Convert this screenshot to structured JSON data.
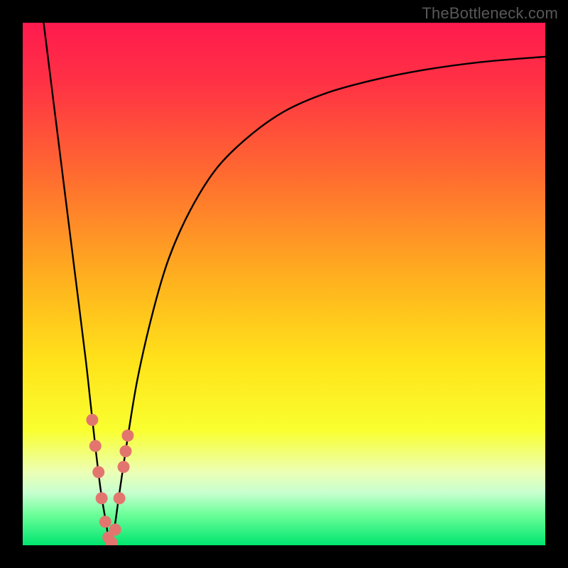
{
  "watermark": "TheBottleneck.com",
  "colors": {
    "frame": "#000000",
    "curve": "#000000",
    "markers": "#e2766f",
    "gradient_stops": [
      {
        "offset": 0.0,
        "color": "#ff1a4e"
      },
      {
        "offset": 0.12,
        "color": "#ff3344"
      },
      {
        "offset": 0.3,
        "color": "#ff6e2f"
      },
      {
        "offset": 0.5,
        "color": "#ffb41e"
      },
      {
        "offset": 0.65,
        "color": "#ffe31a"
      },
      {
        "offset": 0.78,
        "color": "#f9ff2f"
      },
      {
        "offset": 0.86,
        "color": "#ecffb5"
      },
      {
        "offset": 0.9,
        "color": "#c6ffcf"
      },
      {
        "offset": 0.94,
        "color": "#6fff9b"
      },
      {
        "offset": 1.0,
        "color": "#00e56f"
      }
    ]
  },
  "chart_data": {
    "type": "line",
    "title": "",
    "xlabel": "",
    "ylabel": "",
    "xlim": [
      0,
      100
    ],
    "ylim": [
      0,
      100
    ],
    "grid": false,
    "series": [
      {
        "name": "bottleneck-curve",
        "x": [
          4,
          6,
          8,
          10,
          12,
          13,
          14,
          15,
          16,
          16.7,
          17.5,
          18.5,
          20,
          22,
          25,
          28,
          32,
          37,
          43,
          50,
          58,
          67,
          77,
          88,
          100
        ],
        "y": [
          100,
          84,
          68,
          52,
          36,
          27,
          18,
          10,
          4,
          0,
          3,
          10,
          20,
          32,
          45,
          55,
          64,
          72,
          78,
          83,
          86.5,
          89,
          91,
          92.5,
          93.5
        ]
      }
    ],
    "annotations": {
      "markers_near_minimum": [
        {
          "x": 13.3,
          "y": 24
        },
        {
          "x": 13.9,
          "y": 19
        },
        {
          "x": 14.5,
          "y": 14
        },
        {
          "x": 15.1,
          "y": 9
        },
        {
          "x": 15.8,
          "y": 4.5
        },
        {
          "x": 16.4,
          "y": 1.5
        },
        {
          "x": 17.0,
          "y": 0.5
        },
        {
          "x": 17.7,
          "y": 3
        },
        {
          "x": 18.5,
          "y": 9
        },
        {
          "x": 19.3,
          "y": 15
        },
        {
          "x": 19.7,
          "y": 18
        },
        {
          "x": 20.1,
          "y": 21
        }
      ]
    }
  }
}
